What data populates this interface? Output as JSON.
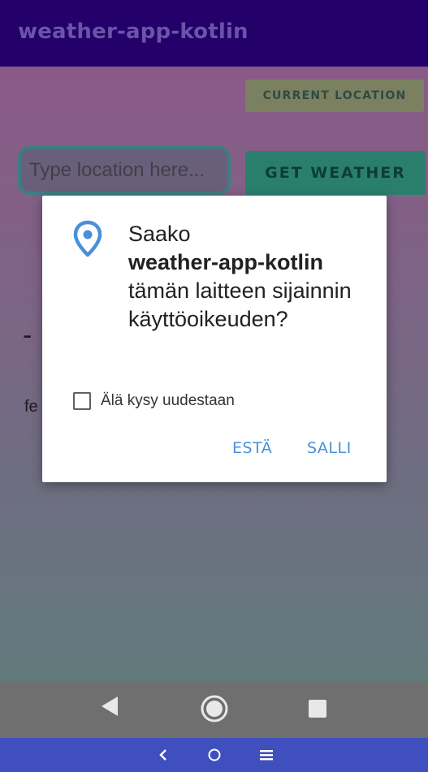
{
  "app_bar": {
    "title": "weather-app-kotlin"
  },
  "main": {
    "current_location_label": "CURRENT LOCATION",
    "location_input": {
      "value": "",
      "placeholder": "Type location here..."
    },
    "get_weather_label": "GET WEATHER",
    "temperature_text": "-",
    "feels_like_text": "fe"
  },
  "dialog": {
    "message_pre": "Saako",
    "app_name": "weather-app-kotlin",
    "message_post": "tämän laitteen sijainnin käyttöoikeuden?",
    "checkbox_label": "Älä kysy uudestaan",
    "checkbox_checked": false,
    "deny_label": "ESTÄ",
    "allow_label": "SALLI",
    "icon": "location-pin-icon",
    "accent_color": "#4a90d9"
  },
  "system_nav": {
    "icons": [
      "back-triangle-icon",
      "home-circle-icon",
      "recents-square-icon"
    ]
  },
  "bottom_bar": {
    "icons": [
      "chevron-left-icon",
      "home-circle-icon",
      "menu-icon"
    ]
  },
  "colors": {
    "app_bar": "#24006a",
    "system_nav": "#6f6f6f",
    "bottom_bar": "#3f4fbe"
  }
}
